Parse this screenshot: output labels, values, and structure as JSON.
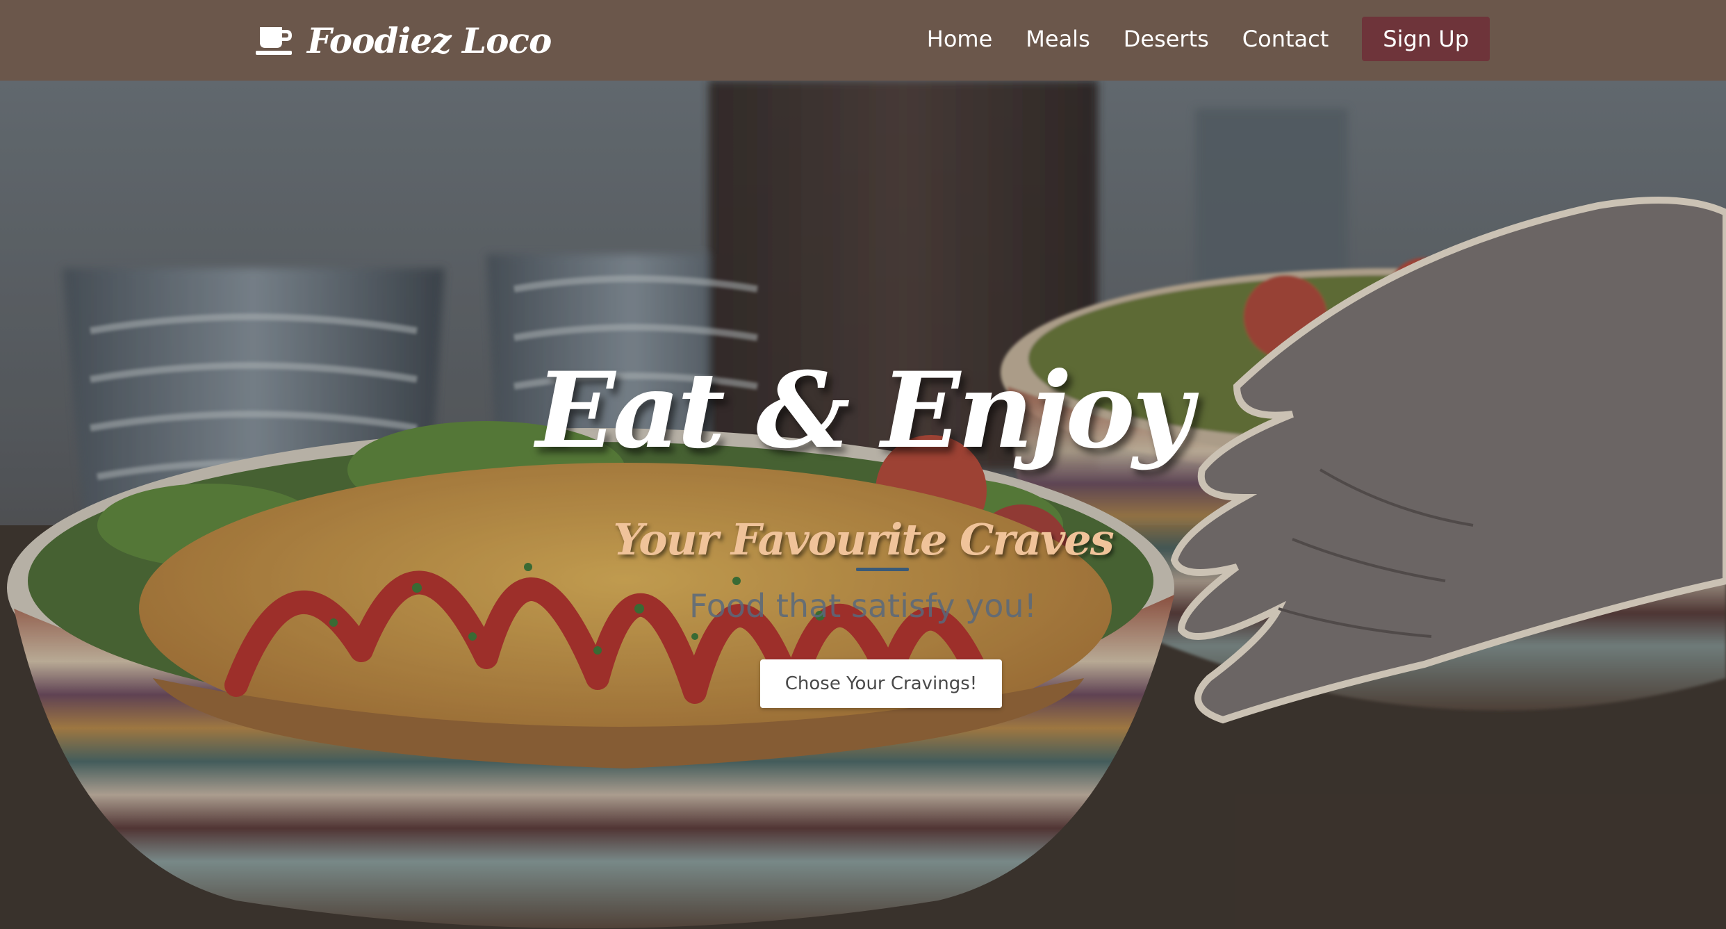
{
  "brand": {
    "name": "Foodiez Loco",
    "icon": "coffee-cup-icon"
  },
  "nav": {
    "links": [
      "Home",
      "Meals",
      "Deserts",
      "Contact"
    ],
    "signup_label": "Sign Up"
  },
  "hero": {
    "title": "Eat & Enjoy",
    "subtitle": "Your Favourite Craves",
    "tagline": "Food that satisfy you!",
    "cta_label": "Chose Your Cravings!"
  },
  "colors": {
    "navbar_bg": "#6b574b",
    "signup_bg": "#6e343a",
    "subtitle": "#f0c39a",
    "title": "#ffffff"
  }
}
